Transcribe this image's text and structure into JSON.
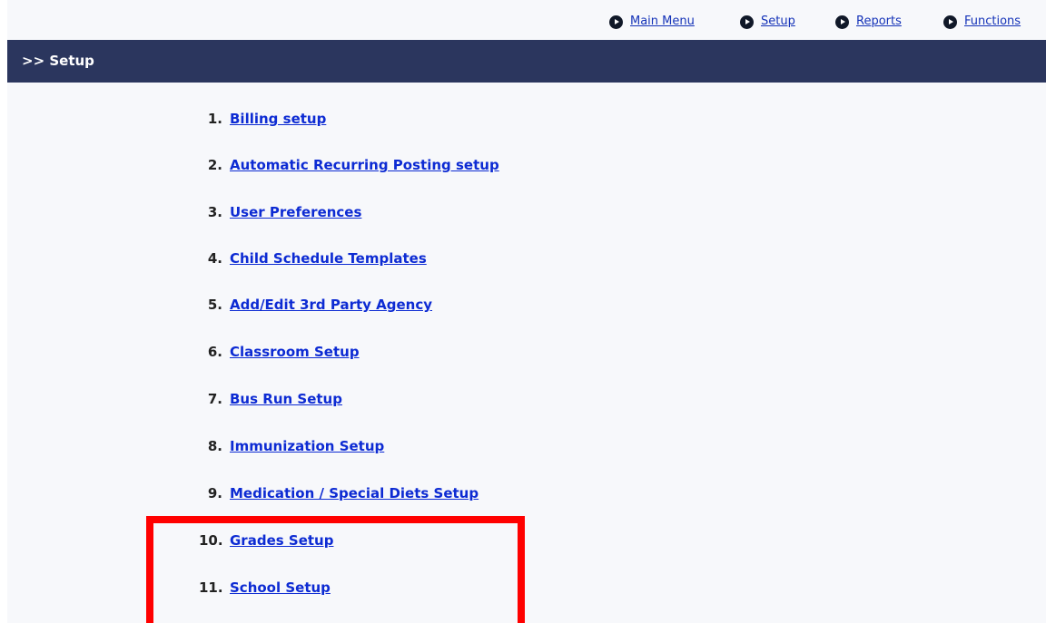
{
  "top_nav": {
    "items": [
      {
        "label": "Main Menu",
        "icon": "circle-arrow-right-icon"
      },
      {
        "label": "Setup",
        "icon": "circle-arrow-right-icon"
      },
      {
        "label": "Reports",
        "icon": "circle-arrow-right-icon"
      },
      {
        "label": "Functions",
        "icon": "circle-arrow-right-icon"
      }
    ]
  },
  "header": {
    "title": ">> Setup"
  },
  "menu": {
    "items": [
      {
        "number": "1.",
        "label": "Billing setup"
      },
      {
        "number": "2.",
        "label": "Automatic Recurring Posting setup"
      },
      {
        "number": "3.",
        "label": "User Preferences"
      },
      {
        "number": "4.",
        "label": "Child Schedule Templates"
      },
      {
        "number": "5.",
        "label": "Add/Edit 3rd Party Agency"
      },
      {
        "number": "6.",
        "label": "Classroom Setup"
      },
      {
        "number": "7.",
        "label": "Bus Run Setup"
      },
      {
        "number": "8.",
        "label": "Immunization Setup"
      },
      {
        "number": "9.",
        "label": "Medication / Special Diets Setup"
      },
      {
        "number": "10.",
        "label": "Grades Setup"
      },
      {
        "number": "11.",
        "label": "School Setup"
      }
    ]
  },
  "colors": {
    "header_bg": "#2b365e",
    "link": "#0d2bd3",
    "highlight": "#ff0000",
    "page_bg": "#f7f8fb"
  }
}
